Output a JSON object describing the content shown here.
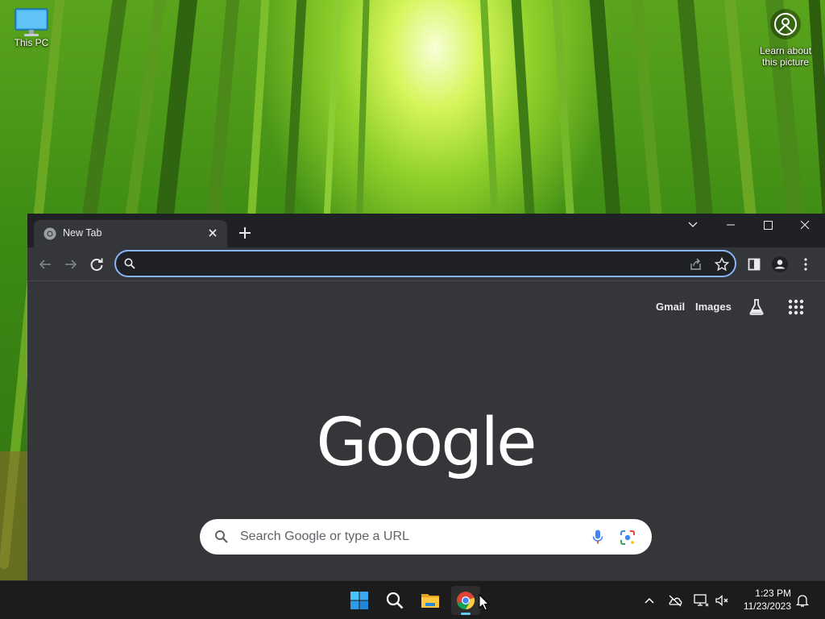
{
  "desktop": {
    "icons": [
      {
        "label": "This PC",
        "icon": "monitor-icon"
      },
      {
        "label": "Learn about this picture",
        "icon": "camera-circle-icon"
      }
    ]
  },
  "browser": {
    "tab": {
      "title": "New Tab",
      "favicon": "chrome-icon"
    },
    "toolbar": {
      "omnibox_value": "",
      "icons": [
        "back-arrow-icon",
        "forward-arrow-icon",
        "reload-icon",
        "search-icon",
        "share-icon",
        "star-icon",
        "side-panel-icon",
        "profile-icon",
        "kebab-menu-icon"
      ]
    },
    "page": {
      "gmail": "Gmail",
      "images": "Images",
      "logo": "Google",
      "search_placeholder": "Search Google or type a URL"
    }
  },
  "taskbar": {
    "apps": [
      "start-icon",
      "search-icon",
      "file-explorer-icon",
      "chrome-icon"
    ],
    "active_app": "chrome",
    "time": "1:23 PM",
    "date": "11/23/2023"
  },
  "colors": {
    "browser_bg": "#35363a",
    "titlebar_bg": "#202124",
    "omnibox_focus": "#8ab4f8",
    "taskbar_bg": "#1c1c1c"
  }
}
